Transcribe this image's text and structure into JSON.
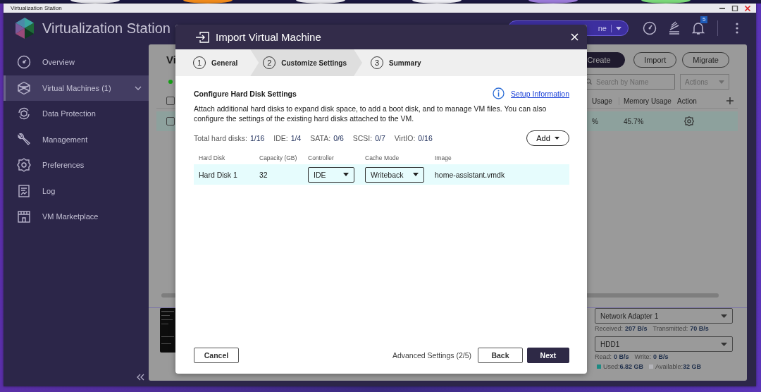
{
  "window": {
    "title": "Virtualization Station"
  },
  "app": {
    "title": "Virtualization Station",
    "selector": {
      "value": "ne"
    },
    "notifications": {
      "count": "5"
    }
  },
  "sidebar": {
    "items": [
      {
        "label": "Overview",
        "selected": false,
        "expandable": false
      },
      {
        "label": "Virtual Machines (1)",
        "selected": true,
        "expandable": true
      },
      {
        "label": "Data Protection",
        "selected": false,
        "expandable": false
      },
      {
        "label": "Management",
        "selected": false,
        "expandable": false
      },
      {
        "label": "Preferences",
        "selected": false,
        "expandable": false
      },
      {
        "label": "Log",
        "selected": false,
        "expandable": false
      },
      {
        "label": "VM Marketplace",
        "selected": false,
        "expandable": false
      }
    ]
  },
  "vm_list": {
    "title": "Vi",
    "buttons": [
      {
        "label": "Create",
        "kind": "primary"
      },
      {
        "label": "Import",
        "kind": "outline"
      },
      {
        "label": "Migrate",
        "kind": "outline"
      }
    ],
    "search": {
      "placeholder": "Search by Name"
    },
    "actions": {
      "label": "Actions"
    },
    "select_all": {
      "checked": false
    },
    "columns": [
      {
        "label": "Usage"
      },
      {
        "label": "Memory Usage"
      },
      {
        "label": "Action"
      }
    ],
    "rows": [
      {
        "checked": false,
        "selected": true,
        "cpu_usage": "%",
        "memory_usage": "45.7%"
      }
    ]
  },
  "details": {
    "network": {
      "value": "Network Adapter 1",
      "stats": [
        {
          "label": "Received:",
          "value": "207 B/s"
        },
        {
          "label": "Transmitted:",
          "value": "70 B/s"
        }
      ]
    },
    "disk": {
      "value": "HDD1",
      "stats": [
        {
          "label": "Read:",
          "value": "0 B/s"
        },
        {
          "label": "Write:",
          "value": "0 B/s"
        }
      ]
    },
    "storage": [
      {
        "label": "Used:",
        "value": "6.82 GB",
        "color": "#1d8a83"
      },
      {
        "label": "Available:",
        "value": "32 GB",
        "color": "#b3b3b8"
      }
    ]
  },
  "dialog": {
    "title": "Import Virtual Machine",
    "steps": [
      {
        "number": "1",
        "label": "General",
        "selected": false
      },
      {
        "number": "2",
        "label": "Customize Settings",
        "selected": true
      },
      {
        "number": "3",
        "label": "Summary",
        "selected": false
      }
    ],
    "section_title": "Configure Hard Disk Settings",
    "help_link": "Setup Information",
    "description": "Attach additional hard disks to expand disk space, to add a boot disk, and to manage VM files. You can also configure the settings of the existing hard disks attached to the VM.",
    "counts": [
      {
        "label": "Total hard disks:",
        "value": "1/16"
      },
      {
        "label": "IDE:",
        "value": "1/4"
      },
      {
        "label": "SATA:",
        "value": "0/6"
      },
      {
        "label": "SCSI:",
        "value": "0/7"
      },
      {
        "label": "VirtIO:",
        "value": "0/16"
      }
    ],
    "add_button": "Add",
    "table": {
      "columns": [
        "Hard Disk",
        "Capacity (GB)",
        "Controller",
        "Cache Mode",
        "Image"
      ],
      "rows": [
        {
          "name": "Hard Disk 1",
          "capacity": "32",
          "controller": "IDE",
          "cache_mode": "Writeback",
          "image": "home-assistant.vmdk",
          "selected": true
        }
      ]
    },
    "footer": {
      "cancel": "Cancel",
      "progress": "Advanced Settings (2/5)",
      "back": "Back",
      "next": "Next"
    }
  }
}
